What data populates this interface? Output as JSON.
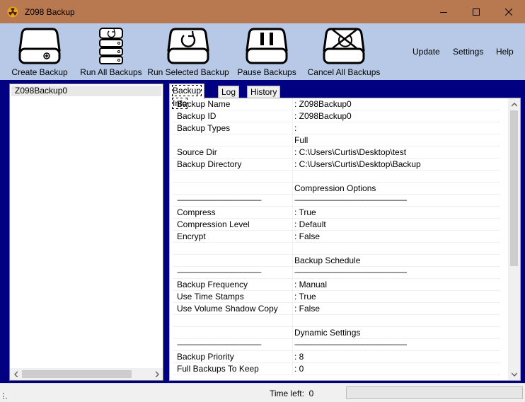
{
  "window": {
    "title": "Z098 Backup",
    "controls": {
      "minimize": "minimize",
      "maximize": "maximize",
      "close": "close"
    }
  },
  "toolbar": {
    "buttons": [
      {
        "label": "Create Backup",
        "icon": "drive-plus-icon"
      },
      {
        "label": "Run All Backups",
        "icon": "server-stack-refresh-icon"
      },
      {
        "label": "Run Selected Backup",
        "icon": "drive-refresh-icon"
      },
      {
        "label": "Pause Backups",
        "icon": "drive-pause-icon"
      },
      {
        "label": "Cancel All Backups",
        "icon": "drive-cancel-icon"
      }
    ],
    "menu": [
      "Update",
      "Settings",
      "Help"
    ]
  },
  "backups_list": {
    "items": [
      "Z098Backup0"
    ]
  },
  "tabs": [
    {
      "label": "Backup Info",
      "active": true
    },
    {
      "label": "Log",
      "active": false
    },
    {
      "label": "History",
      "active": false
    }
  ],
  "info_rows": [
    [
      "Backup Name",
      ": Z098Backup0"
    ],
    [
      "Backup ID",
      ": Z098Backup0"
    ],
    [
      "Backup Types",
      ":"
    ],
    [
      "",
      " Full"
    ],
    [
      "Source Dir",
      ": C:\\Users\\Curtis\\Desktop\\test"
    ],
    [
      "Backup Directory",
      ": C:\\Users\\Curtis\\Desktop\\Backup"
    ],
    [
      "",
      ""
    ],
    [
      "",
      "Compression Options"
    ],
    [
      "---------------------------------------------------",
      "--------------------------------------------------------------------"
    ],
    [
      "Compress",
      ": True"
    ],
    [
      "Compression Level",
      ": Default"
    ],
    [
      "Encrypt",
      ": False"
    ],
    [
      "",
      ""
    ],
    [
      "",
      "Backup Schedule"
    ],
    [
      "---------------------------------------------------",
      "--------------------------------------------------------------------"
    ],
    [
      "Backup Frequency",
      ": Manual"
    ],
    [
      "Use Time Stamps",
      ": True"
    ],
    [
      "Use Volume Shadow Copy",
      ": False"
    ],
    [
      "",
      ""
    ],
    [
      "",
      "Dynamic Settings"
    ],
    [
      "---------------------------------------------------",
      "--------------------------------------------------------------------"
    ],
    [
      "Backup Priority",
      ": 8"
    ],
    [
      "Full Backups To Keep",
      ": 0"
    ]
  ],
  "status": {
    "time_left_label": "Time left:",
    "time_left_value": "0",
    "progress": 0
  },
  "colors": {
    "titlebar": "#b87850",
    "toolbar": "#b7c9e6",
    "main_bg": "#000080"
  }
}
